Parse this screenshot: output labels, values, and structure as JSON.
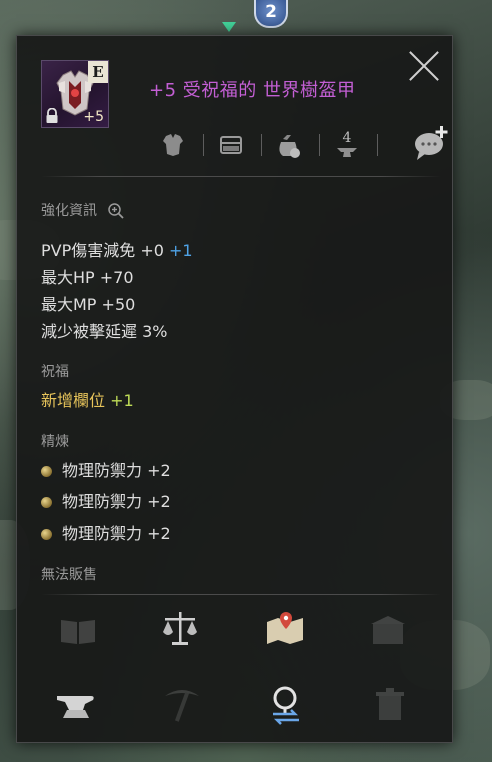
{
  "map": {
    "badge_number": "2"
  },
  "item": {
    "grade_letter": "E",
    "enhance_level": "+5",
    "name": "+5 受祝福的 世界樹盔甲"
  },
  "header_icons": [
    {
      "name": "armor-slot-icon"
    },
    {
      "name": "chest-icon"
    },
    {
      "name": "pouch-icon"
    },
    {
      "name": "anvil-tier-icon",
      "label": "4"
    },
    {
      "name": "chat-bubble-add-icon"
    }
  ],
  "enhance": {
    "title": "強化資訊",
    "stats": [
      {
        "label": "PVP傷害減免 +0",
        "bonus": "+1"
      },
      {
        "label": "最大HP +70",
        "bonus": ""
      },
      {
        "label": "最大MP +50",
        "bonus": ""
      },
      {
        "label": "減少被擊延遲 3%",
        "bonus": ""
      }
    ]
  },
  "blessing": {
    "title": "祝福",
    "line_label": "新增欄位",
    "line_value": "+1"
  },
  "refine": {
    "title": "精煉",
    "lines": [
      "物理防禦力 +2",
      "物理防禦力 +2",
      "物理防禦力 +2"
    ]
  },
  "trade": {
    "status": "無法販售"
  },
  "actions_row1": [
    {
      "name": "book-icon",
      "enabled": false
    },
    {
      "name": "scale-icon",
      "enabled": true
    },
    {
      "name": "map-icon",
      "enabled": true
    },
    {
      "name": "storage-box-icon",
      "enabled": false
    }
  ],
  "actions_row2": [
    {
      "name": "anvil-icon",
      "enabled": true
    },
    {
      "name": "pickaxe-icon",
      "enabled": false
    },
    {
      "name": "magnify-swap-icon",
      "enabled": true
    },
    {
      "name": "trash-icon",
      "enabled": false
    }
  ],
  "colors": {
    "item_name": "#c35fd4",
    "bonus_blue": "#4fa3e6",
    "blessing_gold": "#e6c35a",
    "blessing_green": "#bfdc57"
  }
}
